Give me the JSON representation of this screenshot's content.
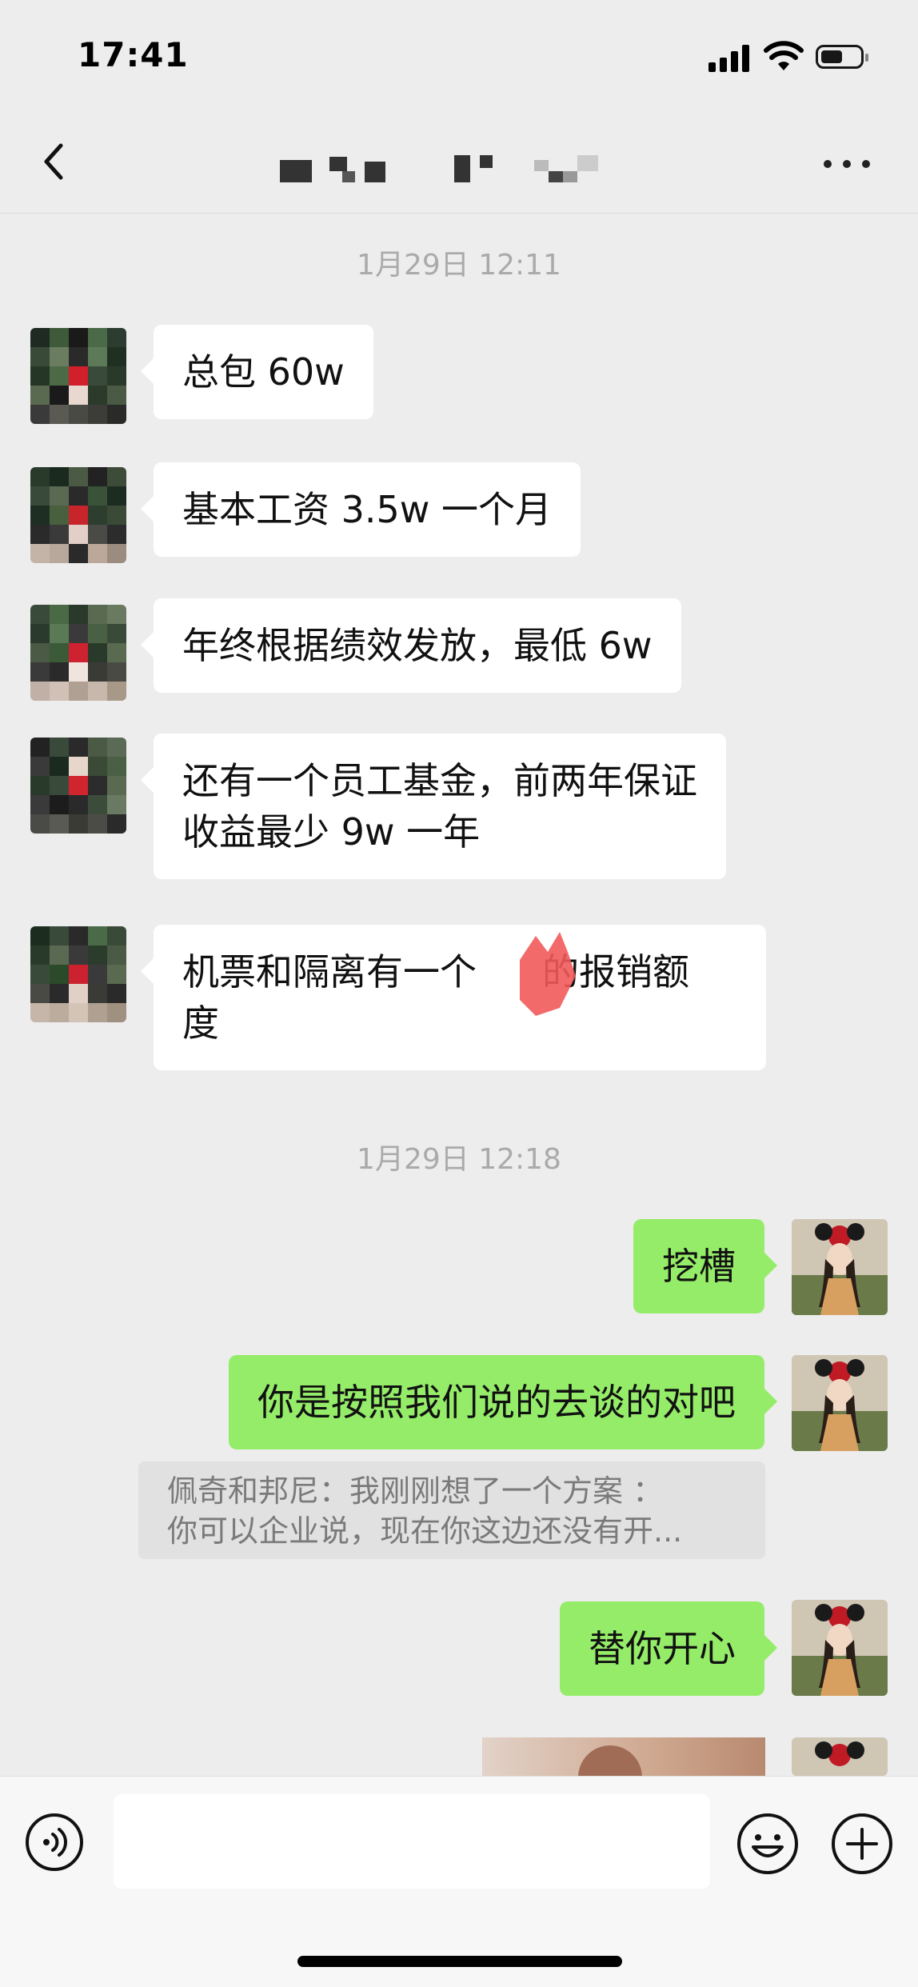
{
  "status_bar": {
    "time": "17:41"
  },
  "nav": {
    "back_icon": "chevron-left-icon",
    "more_icon": "more-dots-icon"
  },
  "chat": {
    "timestamp_1": "1月29日 12:11",
    "messages_left": [
      {
        "lines": [
          "总包 60w"
        ]
      },
      {
        "lines": [
          "基本工资 3.5w 一个月"
        ]
      },
      {
        "lines": [
          "年终根据绩效发放，最低 6w"
        ]
      },
      {
        "lines": [
          "还有一个员工基金，前两年保证",
          "收益最少 9w 一年"
        ]
      },
      {
        "lines": [
          "机票和隔离有一个",
          "的报销额",
          "度"
        ]
      }
    ],
    "timestamp_2": "1月29日 12:18",
    "messages_right": [
      {
        "text": "挖槽"
      },
      {
        "text": "你是按照我们说的去谈的对吧"
      },
      {
        "text": "替你开心"
      }
    ],
    "quote": {
      "line1": "佩奇和邦尼：我刚刚想了一个方案 ：",
      "line2": "你可以企业说，现在你这边还没有开..."
    }
  },
  "input_bar": {
    "voice_icon": "voice-icon",
    "emoji_icon": "emoji-icon",
    "plus_icon": "plus-icon",
    "input_value": ""
  }
}
